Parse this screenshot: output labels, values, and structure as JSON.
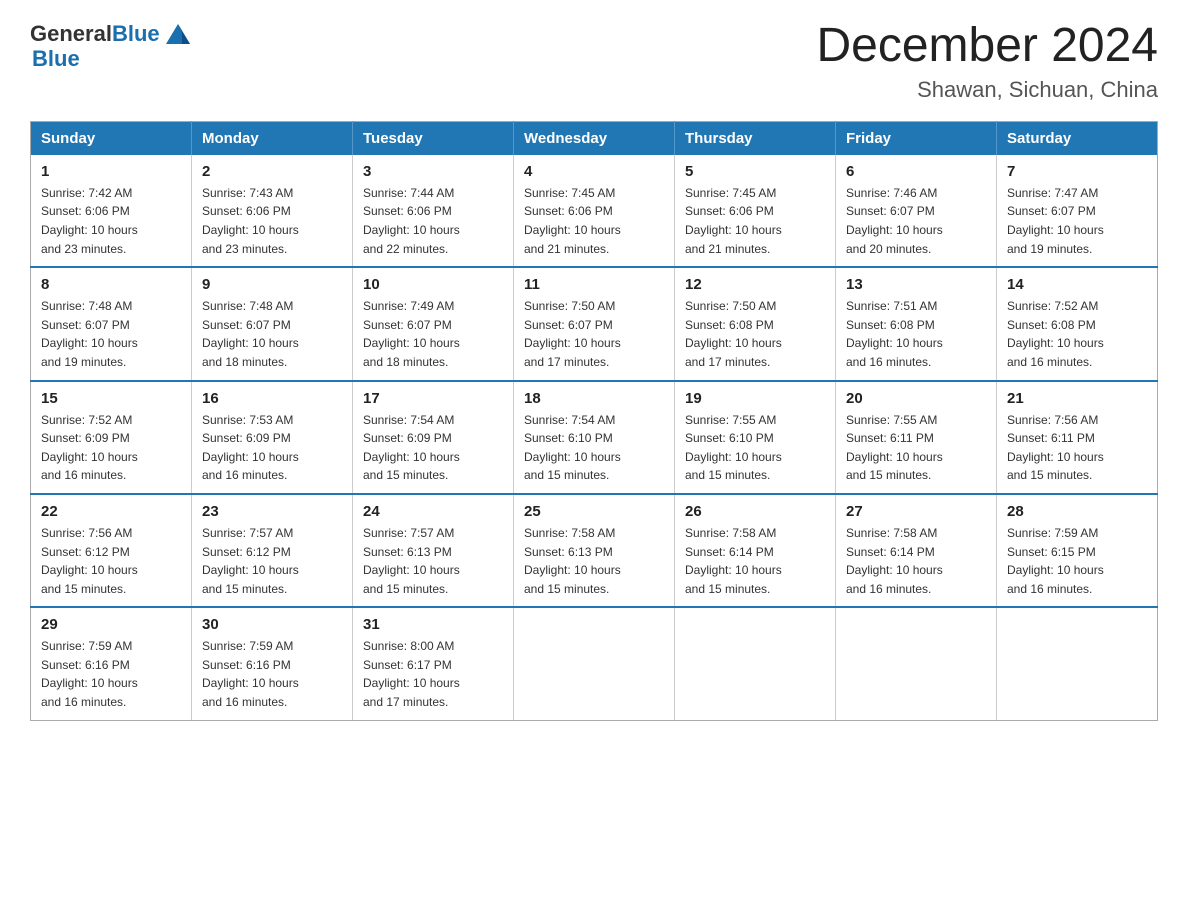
{
  "header": {
    "logo_general": "General",
    "logo_blue": "Blue",
    "title": "December 2024",
    "subtitle": "Shawan, Sichuan, China"
  },
  "weekdays": [
    "Sunday",
    "Monday",
    "Tuesday",
    "Wednesday",
    "Thursday",
    "Friday",
    "Saturday"
  ],
  "weeks": [
    [
      {
        "day": "1",
        "sunrise": "7:42 AM",
        "sunset": "6:06 PM",
        "daylight": "10 hours and 23 minutes."
      },
      {
        "day": "2",
        "sunrise": "7:43 AM",
        "sunset": "6:06 PM",
        "daylight": "10 hours and 23 minutes."
      },
      {
        "day": "3",
        "sunrise": "7:44 AM",
        "sunset": "6:06 PM",
        "daylight": "10 hours and 22 minutes."
      },
      {
        "day": "4",
        "sunrise": "7:45 AM",
        "sunset": "6:06 PM",
        "daylight": "10 hours and 21 minutes."
      },
      {
        "day": "5",
        "sunrise": "7:45 AM",
        "sunset": "6:06 PM",
        "daylight": "10 hours and 21 minutes."
      },
      {
        "day": "6",
        "sunrise": "7:46 AM",
        "sunset": "6:07 PM",
        "daylight": "10 hours and 20 minutes."
      },
      {
        "day": "7",
        "sunrise": "7:47 AM",
        "sunset": "6:07 PM",
        "daylight": "10 hours and 19 minutes."
      }
    ],
    [
      {
        "day": "8",
        "sunrise": "7:48 AM",
        "sunset": "6:07 PM",
        "daylight": "10 hours and 19 minutes."
      },
      {
        "day": "9",
        "sunrise": "7:48 AM",
        "sunset": "6:07 PM",
        "daylight": "10 hours and 18 minutes."
      },
      {
        "day": "10",
        "sunrise": "7:49 AM",
        "sunset": "6:07 PM",
        "daylight": "10 hours and 18 minutes."
      },
      {
        "day": "11",
        "sunrise": "7:50 AM",
        "sunset": "6:07 PM",
        "daylight": "10 hours and 17 minutes."
      },
      {
        "day": "12",
        "sunrise": "7:50 AM",
        "sunset": "6:08 PM",
        "daylight": "10 hours and 17 minutes."
      },
      {
        "day": "13",
        "sunrise": "7:51 AM",
        "sunset": "6:08 PM",
        "daylight": "10 hours and 16 minutes."
      },
      {
        "day": "14",
        "sunrise": "7:52 AM",
        "sunset": "6:08 PM",
        "daylight": "10 hours and 16 minutes."
      }
    ],
    [
      {
        "day": "15",
        "sunrise": "7:52 AM",
        "sunset": "6:09 PM",
        "daylight": "10 hours and 16 minutes."
      },
      {
        "day": "16",
        "sunrise": "7:53 AM",
        "sunset": "6:09 PM",
        "daylight": "10 hours and 16 minutes."
      },
      {
        "day": "17",
        "sunrise": "7:54 AM",
        "sunset": "6:09 PM",
        "daylight": "10 hours and 15 minutes."
      },
      {
        "day": "18",
        "sunrise": "7:54 AM",
        "sunset": "6:10 PM",
        "daylight": "10 hours and 15 minutes."
      },
      {
        "day": "19",
        "sunrise": "7:55 AM",
        "sunset": "6:10 PM",
        "daylight": "10 hours and 15 minutes."
      },
      {
        "day": "20",
        "sunrise": "7:55 AM",
        "sunset": "6:11 PM",
        "daylight": "10 hours and 15 minutes."
      },
      {
        "day": "21",
        "sunrise": "7:56 AM",
        "sunset": "6:11 PM",
        "daylight": "10 hours and 15 minutes."
      }
    ],
    [
      {
        "day": "22",
        "sunrise": "7:56 AM",
        "sunset": "6:12 PM",
        "daylight": "10 hours and 15 minutes."
      },
      {
        "day": "23",
        "sunrise": "7:57 AM",
        "sunset": "6:12 PM",
        "daylight": "10 hours and 15 minutes."
      },
      {
        "day": "24",
        "sunrise": "7:57 AM",
        "sunset": "6:13 PM",
        "daylight": "10 hours and 15 minutes."
      },
      {
        "day": "25",
        "sunrise": "7:58 AM",
        "sunset": "6:13 PM",
        "daylight": "10 hours and 15 minutes."
      },
      {
        "day": "26",
        "sunrise": "7:58 AM",
        "sunset": "6:14 PM",
        "daylight": "10 hours and 15 minutes."
      },
      {
        "day": "27",
        "sunrise": "7:58 AM",
        "sunset": "6:14 PM",
        "daylight": "10 hours and 16 minutes."
      },
      {
        "day": "28",
        "sunrise": "7:59 AM",
        "sunset": "6:15 PM",
        "daylight": "10 hours and 16 minutes."
      }
    ],
    [
      {
        "day": "29",
        "sunrise": "7:59 AM",
        "sunset": "6:16 PM",
        "daylight": "10 hours and 16 minutes."
      },
      {
        "day": "30",
        "sunrise": "7:59 AM",
        "sunset": "6:16 PM",
        "daylight": "10 hours and 16 minutes."
      },
      {
        "day": "31",
        "sunrise": "8:00 AM",
        "sunset": "6:17 PM",
        "daylight": "10 hours and 17 minutes."
      },
      null,
      null,
      null,
      null
    ]
  ],
  "labels": {
    "sunrise": "Sunrise:",
    "sunset": "Sunset:",
    "daylight": "Daylight:"
  }
}
